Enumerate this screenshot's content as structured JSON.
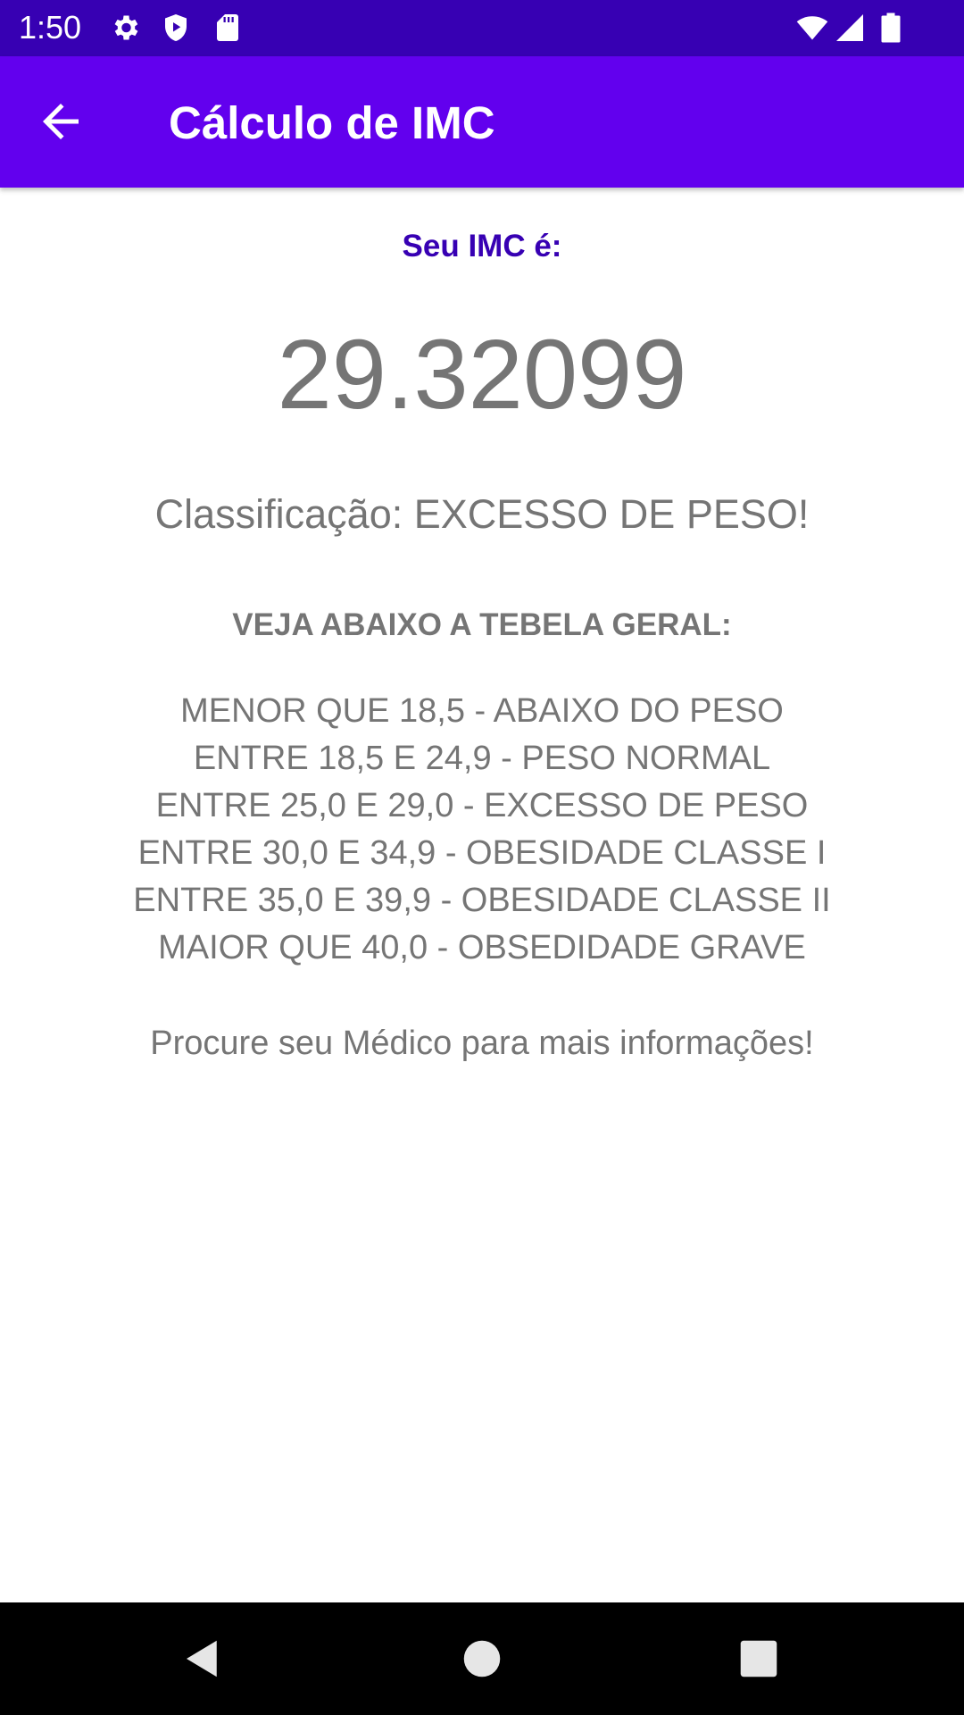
{
  "status_bar": {
    "time": "1:50",
    "icons": [
      "gear-icon",
      "shield-play-icon",
      "sd-card-icon",
      "wifi-icon",
      "signal-icon",
      "battery-icon"
    ],
    "background": "#3700b3"
  },
  "app_bar": {
    "title": "Cálculo de IMC",
    "background": "#6200ee",
    "back_icon": "arrow-back-icon"
  },
  "result": {
    "label": "Seu IMC é:",
    "value": "29.32099",
    "classification": "Classificação: EXCESSO DE PESO!"
  },
  "table": {
    "title": "VEJA ABAIXO A TEBELA GERAL:",
    "rows": [
      "MENOR QUE 18,5 - ABAIXO DO PESO",
      "ENTRE 18,5 E 24,9 - PESO NORMAL",
      "ENTRE 25,0 E 29,0 - EXCESSO DE PESO",
      "ENTRE 30,0 E 34,9 - OBESIDADE CLASSE I",
      "ENTRE 35,0 E 39,9 - OBESIDADE CLASSE II",
      "MAIOR QUE 40,0 - OBSEDIDADE GRAVE"
    ]
  },
  "footer": {
    "text": "Procure seu Médico para mais informações!"
  },
  "nav_bar": {
    "buttons": [
      "back-triangle-icon",
      "home-circle-icon",
      "recents-square-icon"
    ]
  },
  "colors": {
    "accent": "#3700b3",
    "primary": "#6200ee",
    "body_text": "#757575"
  }
}
